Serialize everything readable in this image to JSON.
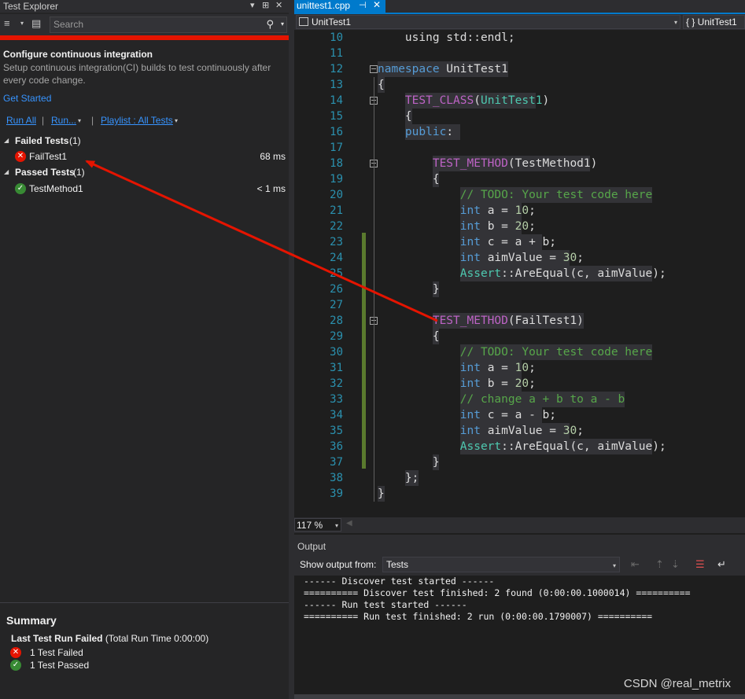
{
  "test_explorer": {
    "title": "Test Explorer",
    "window_controls": [
      "▾",
      "⊞",
      "✕"
    ],
    "search_placeholder": "Search",
    "progress_color": "#e51400",
    "ci": {
      "title": "Configure continuous integration",
      "description": "Setup continuous integration(CI) builds to test continuously after every code change.",
      "link": "Get Started"
    },
    "run_bar": {
      "run_all": "Run All",
      "run": "Run...",
      "playlist": "Playlist : All Tests"
    },
    "groups": [
      {
        "name": "Failed Tests",
        "count": "(1)",
        "tests": [
          {
            "name": "FailTest1",
            "duration": "68 ms",
            "status": "failed"
          }
        ]
      },
      {
        "name": "Passed Tests",
        "count": "(1)",
        "tests": [
          {
            "name": "TestMethod1",
            "duration": "< 1 ms",
            "status": "passed"
          }
        ]
      }
    ],
    "summary": {
      "title": "Summary",
      "last_run_label": "Last Test Run Failed",
      "total_time": "(Total Run Time 0:00:00)",
      "failed": "1 Test Failed",
      "passed": "1 Test Passed"
    }
  },
  "editor": {
    "tab": {
      "filename": "unittest1.cpp",
      "pin": "⊣",
      "close": "✕"
    },
    "nav_left": "UnitTest1",
    "nav_right": "{ } UnitTest1",
    "zoom": "117 %",
    "lines": [
      {
        "n": "10",
        "tokens": [
          [
            "id",
            "using std::endl;"
          ]
        ],
        "indent": "    "
      },
      {
        "n": "11",
        "tokens": [],
        "indent": ""
      },
      {
        "n": "12",
        "tokens": [
          [
            "kw",
            "namespace"
          ],
          [
            "id",
            " UnitTest1"
          ]
        ],
        "indent": ""
      },
      {
        "n": "13",
        "tokens": [
          [
            "id",
            "{"
          ]
        ],
        "indent": ""
      },
      {
        "n": "14",
        "tokens": [
          [
            "mac",
            "TEST_CLASS"
          ],
          [
            "id",
            "("
          ],
          [
            "ty",
            "UnitTest1"
          ],
          [
            "id",
            ")"
          ]
        ],
        "indent": "    "
      },
      {
        "n": "15",
        "tokens": [
          [
            "id",
            "{"
          ]
        ],
        "indent": "    "
      },
      {
        "n": "16",
        "tokens": [
          [
            "kw",
            "public"
          ],
          [
            "id",
            ":"
          ]
        ],
        "indent": "    "
      },
      {
        "n": "17",
        "tokens": [],
        "indent": ""
      },
      {
        "n": "18",
        "tokens": [
          [
            "mac",
            "TEST_METHOD"
          ],
          [
            "id",
            "(TestMethod1)"
          ]
        ],
        "indent": "        "
      },
      {
        "n": "19",
        "tokens": [
          [
            "id",
            "{"
          ]
        ],
        "indent": "        "
      },
      {
        "n": "20",
        "tokens": [
          [
            "cm",
            "// TODO: Your test code here"
          ]
        ],
        "indent": "            "
      },
      {
        "n": "21",
        "tokens": [
          [
            "kw",
            "int"
          ],
          [
            "id",
            " a = "
          ],
          [
            "nm",
            "10"
          ],
          [
            "id",
            ";"
          ]
        ],
        "indent": "            "
      },
      {
        "n": "22",
        "tokens": [
          [
            "kw",
            "int"
          ],
          [
            "id",
            " b = "
          ],
          [
            "nm",
            "20"
          ],
          [
            "id",
            ";"
          ]
        ],
        "indent": "            "
      },
      {
        "n": "23",
        "tokens": [
          [
            "kw",
            "int"
          ],
          [
            "id",
            " c = a + b;"
          ]
        ],
        "indent": "            "
      },
      {
        "n": "24",
        "tokens": [
          [
            "kw",
            "int"
          ],
          [
            "id",
            " aimValue = "
          ],
          [
            "nm",
            "30"
          ],
          [
            "id",
            ";"
          ]
        ],
        "indent": "            "
      },
      {
        "n": "25",
        "tokens": [
          [
            "ty",
            "Assert"
          ],
          [
            "id",
            "::AreEqual(c, aimValue);"
          ]
        ],
        "indent": "            "
      },
      {
        "n": "26",
        "tokens": [
          [
            "id",
            "}"
          ]
        ],
        "indent": "        "
      },
      {
        "n": "27",
        "tokens": [],
        "indent": ""
      },
      {
        "n": "28",
        "tokens": [
          [
            "mac",
            "TEST_METHOD"
          ],
          [
            "id",
            "(FailTest1)"
          ]
        ],
        "indent": "        "
      },
      {
        "n": "29",
        "tokens": [
          [
            "id",
            "{"
          ]
        ],
        "indent": "        "
      },
      {
        "n": "30",
        "tokens": [
          [
            "cm",
            "// TODO: Your test code here"
          ]
        ],
        "indent": "            "
      },
      {
        "n": "31",
        "tokens": [
          [
            "kw",
            "int"
          ],
          [
            "id",
            " a = "
          ],
          [
            "nm",
            "10"
          ],
          [
            "id",
            ";"
          ]
        ],
        "indent": "            "
      },
      {
        "n": "32",
        "tokens": [
          [
            "kw",
            "int"
          ],
          [
            "id",
            " b = "
          ],
          [
            "nm",
            "20"
          ],
          [
            "id",
            ";"
          ]
        ],
        "indent": "            "
      },
      {
        "n": "33",
        "tokens": [
          [
            "cm",
            "// change a + b to a - b"
          ]
        ],
        "indent": "            "
      },
      {
        "n": "34",
        "tokens": [
          [
            "kw",
            "int"
          ],
          [
            "id",
            " c = a - b;"
          ]
        ],
        "indent": "            "
      },
      {
        "n": "35",
        "tokens": [
          [
            "kw",
            "int"
          ],
          [
            "id",
            " aimValue = "
          ],
          [
            "nm",
            "30"
          ],
          [
            "id",
            ";"
          ]
        ],
        "indent": "            "
      },
      {
        "n": "36",
        "tokens": [
          [
            "ty",
            "Assert"
          ],
          [
            "id",
            "::AreEqual(c, aimValue);"
          ]
        ],
        "indent": "            "
      },
      {
        "n": "37",
        "tokens": [
          [
            "id",
            "}"
          ]
        ],
        "indent": "        "
      },
      {
        "n": "38",
        "tokens": [
          [
            "id",
            "};"
          ]
        ],
        "indent": "    "
      },
      {
        "n": "39",
        "tokens": [
          [
            "id",
            "}"
          ]
        ],
        "indent": ""
      }
    ]
  },
  "output": {
    "title": "Output",
    "show_from_label": "Show output from:",
    "source": "Tests",
    "text": "------ Discover test started ------\n========== Discover test finished: 2 found (0:00:00.1000014) ==========\n------ Run test started ------\n========== Run test finished: 2 run (0:00:00.1790007) =========="
  },
  "watermark": "CSDN @real_metrix"
}
